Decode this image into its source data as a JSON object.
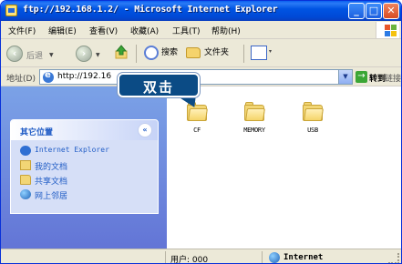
{
  "window": {
    "title": "ftp://192.168.1.2/ - Microsoft Internet Explorer",
    "minimize_glyph": "_",
    "maximize_glyph": "□",
    "close_glyph": "✕"
  },
  "menu": [
    "文件(F)",
    "编辑(E)",
    "查看(V)",
    "收藏(A)",
    "工具(T)",
    "帮助(H)"
  ],
  "toolbar": {
    "back_label": "后退",
    "forward_glyph": "›",
    "back_glyph": "‹",
    "search_label": "搜索",
    "folders_label": "文件夹",
    "views_glyph": "▾"
  },
  "address": {
    "label": "地址(D)",
    "value": "http://192.16",
    "go_label": "转到",
    "links_label": "链接"
  },
  "other_places": {
    "title": "其它位置",
    "collapse_glyph": "«",
    "items": [
      {
        "label": "Internet Explorer",
        "icon": "ie-icon"
      },
      {
        "label": "我的文档",
        "icon": "documents-icon"
      },
      {
        "label": "共享文档",
        "icon": "shared-folder-icon"
      },
      {
        "label": "网上邻居",
        "icon": "network-icon"
      }
    ]
  },
  "folders": [
    {
      "label": "CF"
    },
    {
      "label": "MEMORY"
    },
    {
      "label": "USB"
    }
  ],
  "callout": {
    "text": "双击"
  },
  "status": {
    "user": "用户: 000",
    "zone": "Internet"
  },
  "colors": {
    "titlebar": "#0054E3",
    "callout": "#0B4B85",
    "task_link": "#215DC6"
  }
}
